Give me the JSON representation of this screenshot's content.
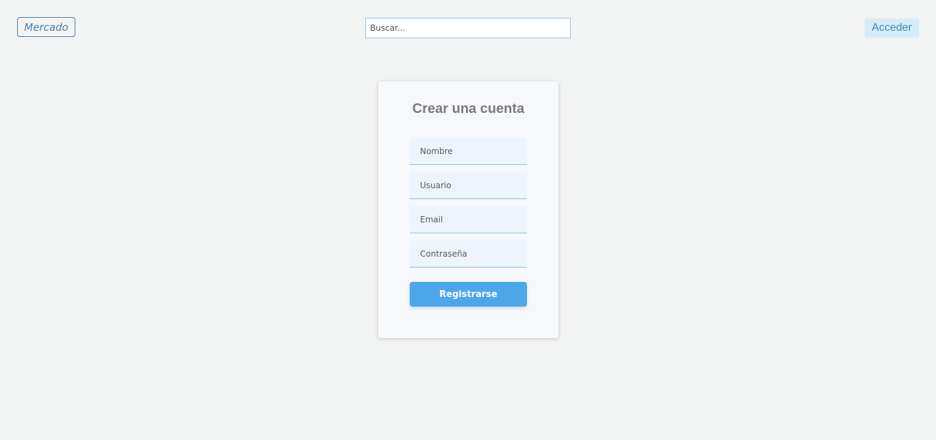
{
  "header": {
    "logo_text": "Mercado",
    "search_placeholder": "Buscar...",
    "search_value": "",
    "login_label": "Acceder"
  },
  "signup_form": {
    "title": "Crear una cuenta",
    "fields": [
      {
        "placeholder": "Nombre",
        "value": ""
      },
      {
        "placeholder": "Usuario",
        "value": ""
      },
      {
        "placeholder": "Email",
        "value": ""
      },
      {
        "placeholder": "Contraseña",
        "value": ""
      }
    ],
    "submit_label": "Registrarse"
  },
  "colors": {
    "page_background": "#f2f3f3",
    "accent": "#4da6e8",
    "logo": "#4a7fa8",
    "login_background": "#d6ecf6",
    "field_underline": "#7cc8d8"
  }
}
